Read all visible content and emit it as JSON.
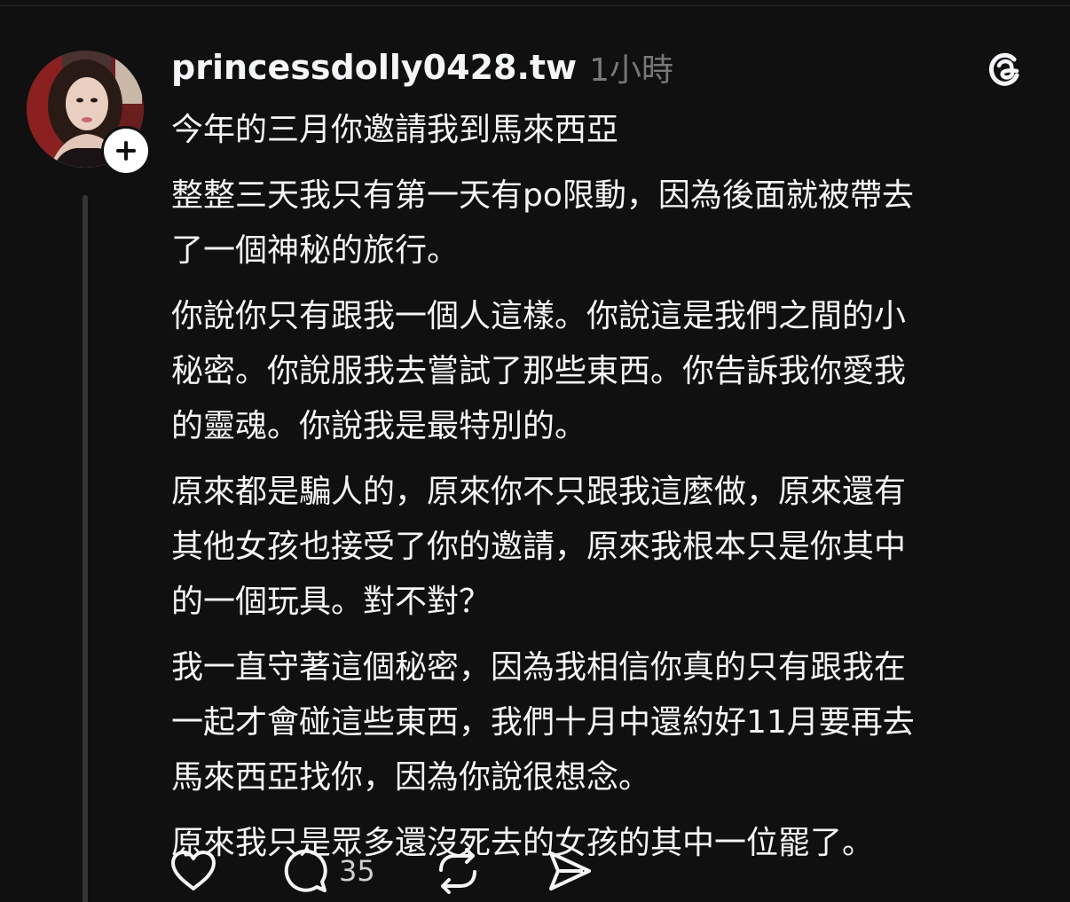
{
  "post": {
    "username": "princessdolly0428.tw",
    "timestamp": "1小時",
    "paragraphs": [
      "今年的三月你邀請我到馬來西亞",
      "整整三天我只有第一天有po限動，因為後面就被帶去\n了一個神秘的旅行。",
      "你說你只有跟我一個人這樣。你說這是我們之間的小\n秘密。你說服我去嘗試了那些東西。你告訴我你愛我\n的靈魂。你說我是最特別的。",
      "原來都是騙人的，原來你不只跟我這麼做，原來還有\n其他女孩也接受了你的邀請，原來我根本只是你其中\n的一個玩具。對不對？",
      "我一直守著這個秘密，因為我相信你真的只有跟我在\n一起才會碰這些東西，我們十月中還約好11月要再去\n馬來西亞找你，因為你說很想念。",
      "原來我只是眾多還沒死去的女孩的其中一位罷了。"
    ]
  },
  "actions": {
    "like_icon": "heart-icon",
    "reply_icon": "comment-icon",
    "reply_count": "35",
    "repost_icon": "repost-icon",
    "share_icon": "send-icon"
  },
  "icons": {
    "follow": "plus-icon",
    "app_logo": "threads-logo-icon"
  },
  "colors": {
    "background": "#101010",
    "text": "#f3f5f7",
    "muted": "#777777",
    "thread_line": "#333638"
  }
}
